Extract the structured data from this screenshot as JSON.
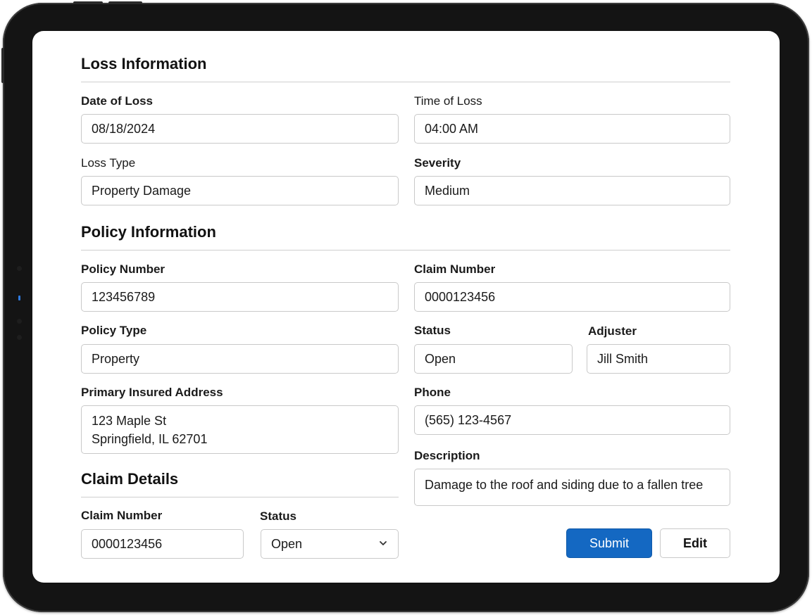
{
  "loss_information": {
    "title": "Loss Information",
    "date_of_loss": {
      "label": "Date of Loss",
      "value": "08/18/2024"
    },
    "time_of_loss": {
      "label": "Time of Loss",
      "value": "04:00 AM"
    },
    "loss_type": {
      "label": "Loss Type",
      "value": "Property Damage"
    },
    "severity": {
      "label": "Severity",
      "value": "Medium"
    }
  },
  "policy_information": {
    "title": "Policy Information",
    "policy_number": {
      "label": "Policy Number",
      "value": "123456789"
    },
    "claim_number": {
      "label": "Claim Number",
      "value": "0000123456"
    },
    "policy_type": {
      "label": "Policy Type",
      "value": "Property"
    },
    "status": {
      "label": "Status",
      "value": "Open"
    },
    "adjuster": {
      "label": "Adjuster",
      "value": "Jill Smith"
    },
    "primary_insured_address": {
      "label": "Primary Insured Address",
      "line1": "123 Maple St",
      "line2": "Springfield, IL 62701"
    },
    "phone": {
      "label": "Phone",
      "value": "(565) 123-4567"
    },
    "description": {
      "label": "Description",
      "value": "Damage to the roof and siding due to a fallen tree"
    }
  },
  "claim_details": {
    "title": "Claim Details",
    "claim_number": {
      "label": "Claim Number",
      "value": "0000123456"
    },
    "status": {
      "label": "Status",
      "value": "Open"
    }
  },
  "actions": {
    "submit_label": "Submit",
    "edit_label": "Edit"
  },
  "colors": {
    "primary_button": "#1468c2",
    "device_frame": "#141414"
  },
  "icons": {
    "status_dropdown": "chevron-down-icon"
  }
}
